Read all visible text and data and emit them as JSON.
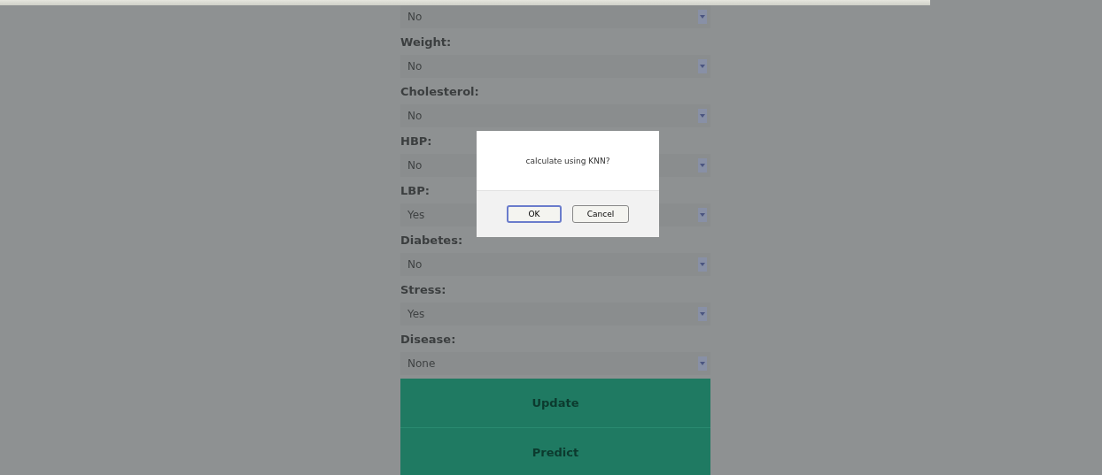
{
  "top_select": {
    "value": "No"
  },
  "fields": [
    {
      "label": "Weight:",
      "value": "No"
    },
    {
      "label": "Cholesterol:",
      "value": "No"
    },
    {
      "label": "HBP:",
      "value": "No"
    },
    {
      "label": "LBP:",
      "value": "Yes"
    },
    {
      "label": "Diabetes:",
      "value": "No"
    },
    {
      "label": "Stress:",
      "value": "Yes"
    },
    {
      "label": "Disease:",
      "value": "None"
    }
  ],
  "buttons": [
    "Update",
    "Predict"
  ],
  "dialog": {
    "message": "calculate using KNN?",
    "buttons": [
      {
        "label": "OK",
        "selected": true
      },
      {
        "label": "Cancel",
        "selected": false
      }
    ]
  }
}
